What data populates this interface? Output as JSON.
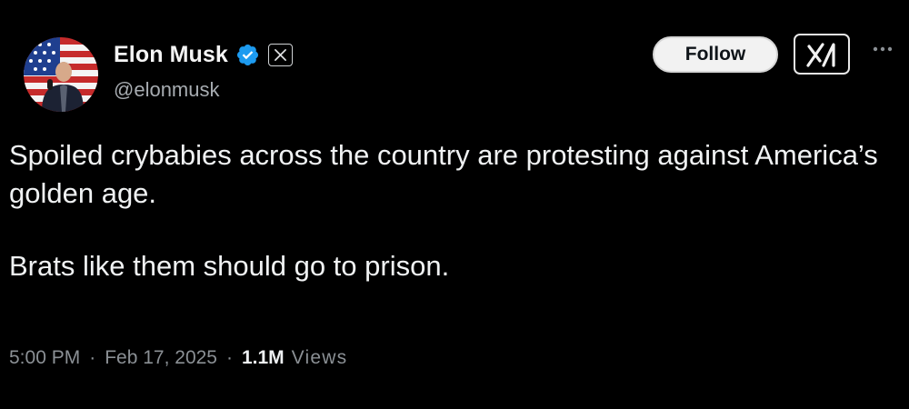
{
  "author": {
    "display_name": "Elon Musk",
    "handle": "@elonmusk",
    "verified_icon": "verified-badge-icon",
    "affiliate_icon": "x-logo-icon",
    "avatar_icon": "avatar-photo-american-flag"
  },
  "actions": {
    "follow_label": "Follow",
    "grok_icon": "grok-icon",
    "more_icon": "more-options-icon"
  },
  "tweet": {
    "paragraphs": [
      "Spoiled crybabies across the country are protesting against America’s golden age.",
      "Brats like them should go to prison."
    ],
    "time": "5:00 PM",
    "date": "Feb 17, 2025",
    "separator": "·",
    "views_count": "1.1M",
    "views_label": "Views"
  },
  "colors": {
    "background": "#000000",
    "text": "#f0f2f3",
    "secondary_text": "#8b9095",
    "verified_blue": "#1d9bf0",
    "follow_bg": "#f2f2f2"
  }
}
